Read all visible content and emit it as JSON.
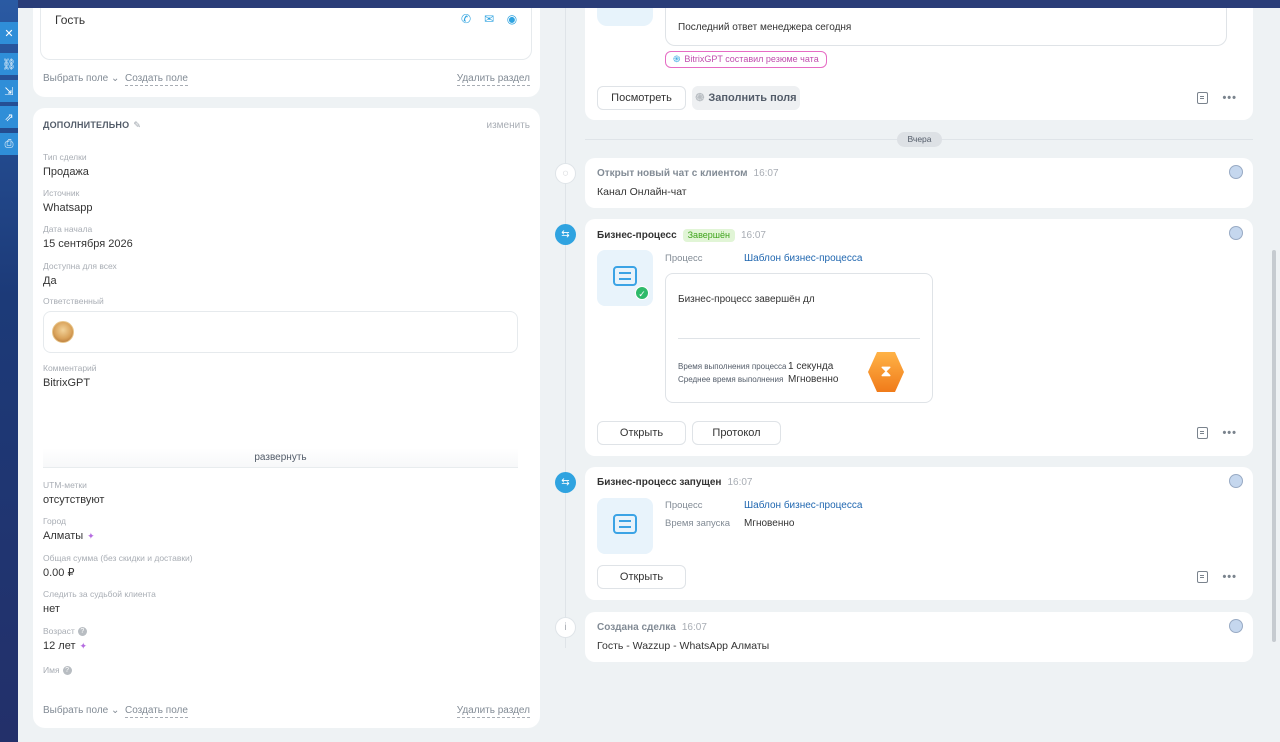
{
  "left_section_top": {
    "contact_name": "Гость",
    "footer": {
      "pick_field": "Выбрать поле",
      "create_field": "Создать поле",
      "delete_section": "Удалить раздел"
    }
  },
  "left_section_main": {
    "title": "ДОПОЛНИТЕЛЬНО",
    "change": "изменить",
    "fields": {
      "deal_type": {
        "label": "Тип сделки",
        "value": "Продажа"
      },
      "source": {
        "label": "Источник",
        "value": "Whatsapp"
      },
      "start_date": {
        "label": "Дата начала",
        "value": "15 сентября 2026"
      },
      "available_all": {
        "label": "Доступна для всех",
        "value": "Да"
      },
      "responsible": {
        "label": "Ответственный"
      },
      "comment": {
        "label": "Комментарий",
        "value": "BitrixGPT"
      },
      "utm": {
        "label": "UTM-метки",
        "value": "отсутствуют"
      },
      "city": {
        "label": "Город",
        "value": "Алматы"
      },
      "total": {
        "label": "Общая сумма (без скидки и доставки)",
        "value": "0.00 ₽"
      },
      "follow": {
        "label": "Следить за судьбой клиента",
        "value": "нет"
      },
      "age": {
        "label": "Возраст",
        "value": "12 лет"
      },
      "name": {
        "label": "Имя"
      }
    },
    "expand": "развернуть",
    "footer": {
      "pick_field": "Выбрать поле",
      "create_field": "Создать поле",
      "delete_section": "Удалить раздел"
    }
  },
  "timeline": {
    "summary_card": {
      "summary_text": "Последний ответ менеджера сегодня",
      "gpt_tag": "BitrixGPT составил резюме чата",
      "view_button": "Посмотреть",
      "fill_button": "Заполнить поля"
    },
    "date_divider": "Вчера",
    "chat_opened": {
      "title": "Открыт новый чат с клиентом",
      "time": "16:07",
      "body": "Канал Онлайн-чат"
    },
    "bp_done": {
      "title": "Бизнес-процесс",
      "status": "Завершён",
      "time": "16:07",
      "process_label": "Процесс",
      "process_value": "Шаблон бизнес-процесса",
      "result_text": "Бизнес-процесс завершён дл",
      "exec_time_label": "Время выполнения процесса",
      "exec_time_value": "1 секунда",
      "avg_time_label": "Среднее время выполнения",
      "avg_time_value": "Мгновенно",
      "open_button": "Открыть",
      "protocol_button": "Протокол"
    },
    "bp_started": {
      "title": "Бизнес-процесс запущен",
      "time": "16:07",
      "process_label": "Процесс",
      "process_value": "Шаблон бизнес-процесса",
      "start_label": "Время запуска",
      "start_value": "Мгновенно",
      "open_button": "Открыть"
    },
    "deal_created": {
      "title": "Создана сделка",
      "time": "16:07",
      "body": "Гость - Wazzup - WhatsApp Алматы"
    }
  }
}
